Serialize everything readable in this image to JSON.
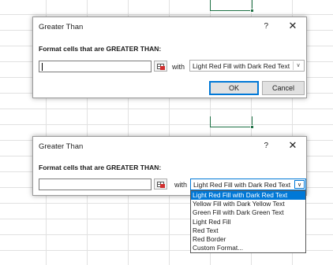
{
  "dialog1": {
    "title": "Greater Than",
    "help": "?",
    "close": "✕",
    "prompt": "Format cells that are GREATER THAN:",
    "input_value": "",
    "with_label": "with",
    "format_selected": "Light Red Fill with Dark Red Text",
    "ok_label": "OK",
    "cancel_label": "Cancel"
  },
  "dialog2": {
    "title": "Greater Than",
    "help": "?",
    "close": "✕",
    "prompt": "Format cells that are GREATER THAN:",
    "input_value": "",
    "with_label": "with",
    "format_selected": "Light Red Fill with Dark Red Text",
    "dropdown_icon": "chevron-down-icon",
    "options": [
      "Light Red Fill with Dark Red Text",
      "Yellow Fill with Dark Yellow Text",
      "Green Fill with Dark Green Text",
      "Light Red Fill",
      "Red Text",
      "Red Border",
      "Custom Format..."
    ],
    "selected_option_index": 0
  },
  "colors": {
    "accent": "#0078d7",
    "selection_border": "#1e7145",
    "gridline": "#e1e1e1"
  }
}
